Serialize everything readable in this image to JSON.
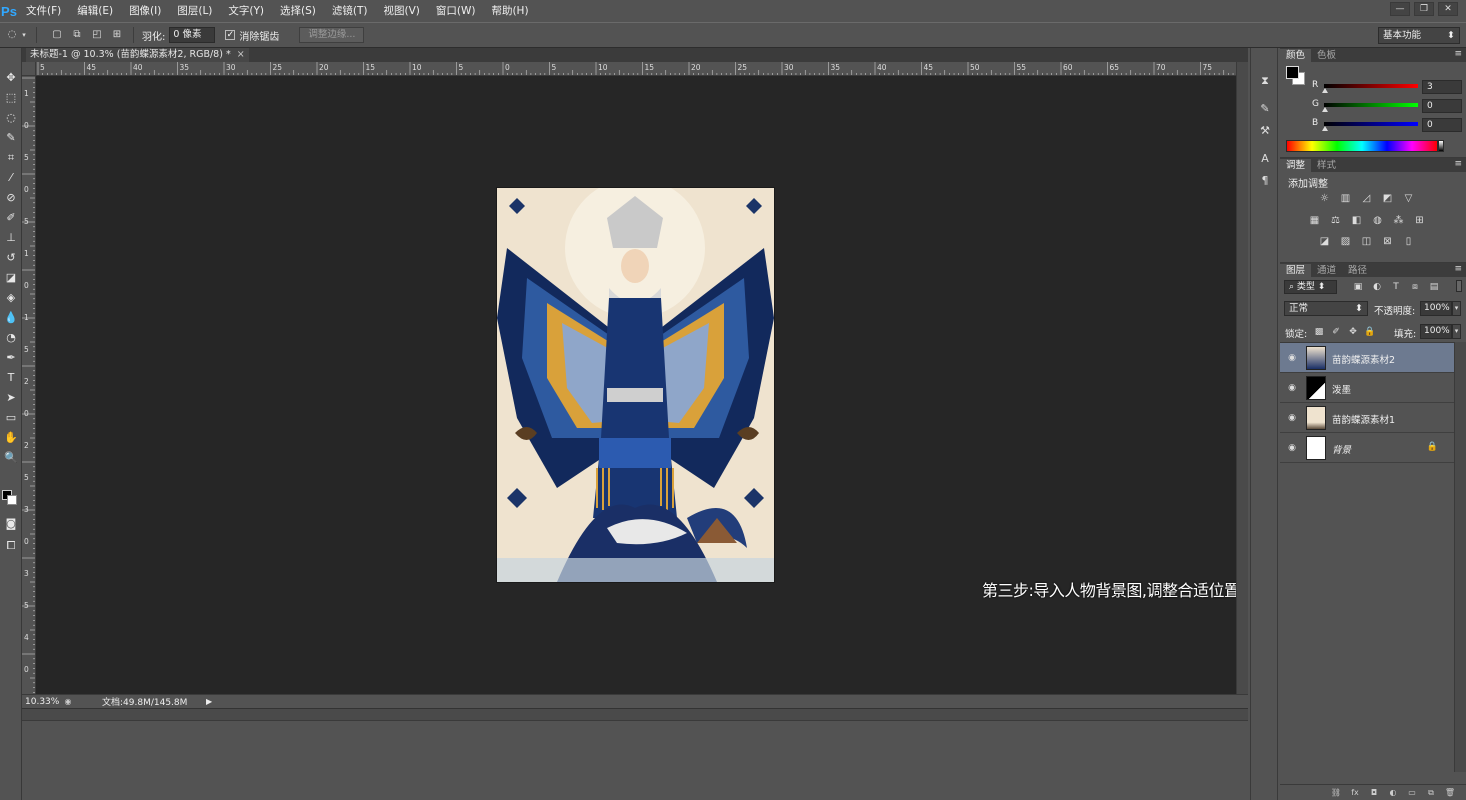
{
  "app": {
    "logo": "Ps"
  },
  "menu": [
    "文件(F)",
    "编辑(E)",
    "图像(I)",
    "图层(L)",
    "文字(Y)",
    "选择(S)",
    "滤镜(T)",
    "视图(V)",
    "窗口(W)",
    "帮助(H)"
  ],
  "window_controls": {
    "minimize": "—",
    "restore": "❐",
    "close": "✕"
  },
  "options": {
    "feather_label": "羽化:",
    "feather_value": "0 像素",
    "antialias_label": "消除锯齿",
    "antialias_checked": true,
    "refine_edge_label": "调整边缘...",
    "workspace": "基本功能"
  },
  "document": {
    "tab_title": "未标题-1 @ 10.3% (苗韵蝶源素材2, RGB/8) *",
    "zoom": "10.33%",
    "doc_info": "文档:49.8M/145.8M"
  },
  "rulers": {
    "top": [
      "5",
      "45",
      "40",
      "35",
      "30",
      "25",
      "20",
      "15",
      "10",
      "5",
      "0",
      "5",
      "10",
      "15",
      "20",
      "25",
      "30",
      "35",
      "40",
      "45",
      "50",
      "55",
      "60",
      "65",
      "70",
      "75"
    ],
    "left": [
      "1",
      "0",
      "5",
      "0",
      "5",
      "1",
      "0",
      "1",
      "5",
      "2",
      "0",
      "2",
      "5",
      "3",
      "0",
      "3",
      "5",
      "4",
      "0"
    ]
  },
  "caption": "第三步:导入人物背景图,调整合适位置图层放置在泼墨图层上面",
  "panels": {
    "color": {
      "tabs": [
        "颜色",
        "色板"
      ],
      "channels": [
        {
          "label": "R",
          "value": "3"
        },
        {
          "label": "G",
          "value": "0"
        },
        {
          "label": "B",
          "value": "0"
        }
      ]
    },
    "adjustments": {
      "tabs": [
        "调整",
        "样式"
      ],
      "title": "添加调整"
    },
    "layers": {
      "tabs": [
        "图层",
        "通道",
        "路径"
      ],
      "filter": "类型",
      "blend_mode": "正常",
      "opacity_label": "不透明度:",
      "opacity": "100%",
      "lock_label": "锁定:",
      "fill_label": "填充:",
      "fill": "100%",
      "items": [
        {
          "name": "苗韵蝶源素材2",
          "selected": true
        },
        {
          "name": "泼墨",
          "selected": false
        },
        {
          "name": "苗韵蝶源素材1",
          "selected": false
        },
        {
          "name": "背景",
          "selected": false,
          "locked": true
        }
      ]
    }
  },
  "colors": {
    "accent_selected": "#6d7a90",
    "canvas": "#262626",
    "ui": "#535353"
  }
}
